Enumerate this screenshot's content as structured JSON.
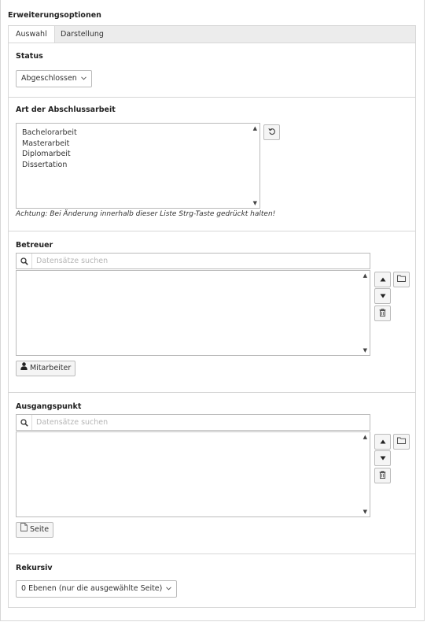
{
  "section": {
    "title": "Erweiterungsoptionen"
  },
  "tabs": [
    {
      "label": "Auswahl",
      "active": true
    },
    {
      "label": "Darstellung",
      "active": false
    }
  ],
  "status": {
    "label": "Status",
    "selected": "Abgeschlossen"
  },
  "art": {
    "label": "Art der Abschlussarbeit",
    "options": [
      "Bachelorarbeit",
      "Masterarbeit",
      "Diplomarbeit",
      "Dissertation"
    ],
    "note": "Achtung: Bei Änderung innerhalb dieser Liste Strg-Taste gedrückt halten!"
  },
  "betreuer": {
    "label": "Betreuer",
    "search_placeholder": "Datensätze suchen",
    "add_button": "Mitarbeiter"
  },
  "ausgangspunkt": {
    "label": "Ausgangspunkt",
    "search_placeholder": "Datensätze suchen",
    "add_button": "Seite"
  },
  "rekursiv": {
    "label": "Rekursiv",
    "selected": "0 Ebenen (nur die ausgewählte Seite)"
  },
  "icons": {
    "select_chevron": "chevron-down-icon",
    "reset": "undo-icon",
    "search": "search-icon",
    "move_up": "triangle-up-icon",
    "move_down": "triangle-down-icon",
    "delete": "trash-icon",
    "browse": "folder-icon",
    "user": "user-icon",
    "page": "page-icon"
  }
}
